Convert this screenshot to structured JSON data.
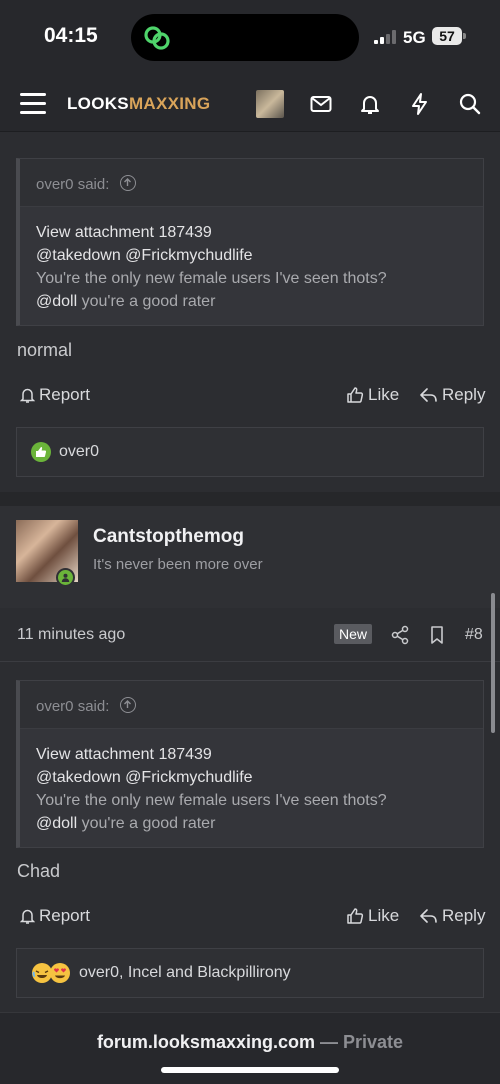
{
  "status": {
    "time": "04:15",
    "network": "5G",
    "battery": "57"
  },
  "nav": {
    "logo_a": "LOOKS",
    "logo_b": "MAXXING"
  },
  "post1": {
    "quote_author": "over0 said:",
    "quote_lines": [
      {
        "text": "View attachment 187439"
      },
      {
        "text": "@takedown @Frickmychudlife"
      },
      {
        "text": "You're the only new female users I've seen thots?"
      }
    ],
    "quote_last_mention": "@doll",
    "quote_last_rest": " you're a good rater",
    "message": "normal",
    "report": "Report",
    "like": "Like",
    "reply": "Reply",
    "reactions": "over0"
  },
  "post2": {
    "username": "Cantstopthemog",
    "user_title": "It's never been more over",
    "time": "11 minutes ago",
    "badge": "New",
    "number": "#8",
    "quote_author": "over0 said:",
    "quote_lines": [
      {
        "text": "View attachment 187439"
      },
      {
        "text": "@takedown @Frickmychudlife"
      },
      {
        "text": "You're the only new female users I've seen thots?"
      }
    ],
    "quote_last_mention": "@doll",
    "quote_last_rest": " you're a good rater",
    "message": "Chad",
    "report": "Report",
    "like": "Like",
    "reply": "Reply",
    "reactions": "over0, Incel and Blackpillirony"
  },
  "url": {
    "domain": "forum.looksmaxxing.com",
    "sep": " — ",
    "mode": "Private"
  },
  "colors": {
    "accent": "#d9a45a",
    "online": "#6bb43a",
    "background": "#2a2b2f"
  }
}
